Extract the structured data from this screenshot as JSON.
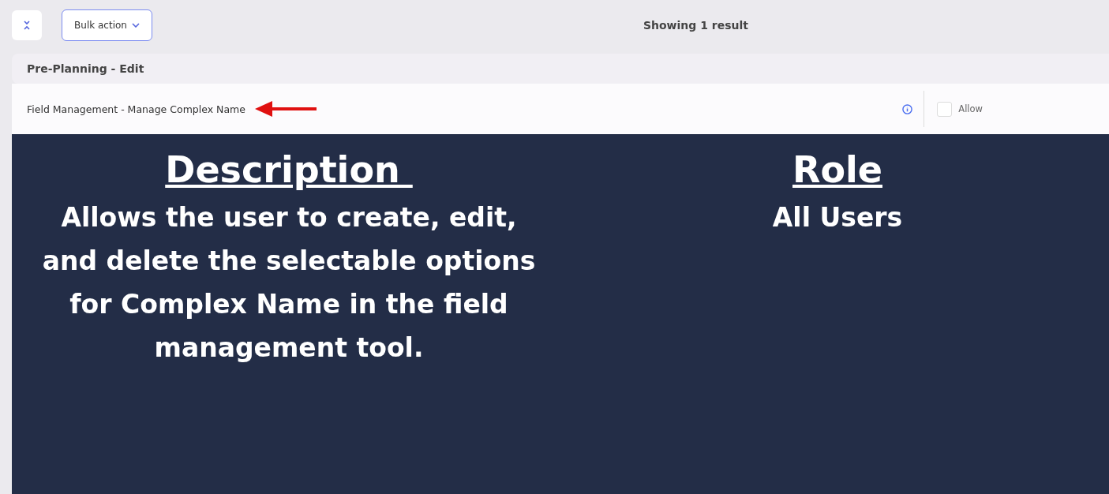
{
  "toolbar": {
    "bulk_action": "Bulk action",
    "result_count": "Showing 1 result"
  },
  "section": {
    "title": "Pre-Planning - Edit"
  },
  "permission": {
    "name": "Field Management - Manage Complex Name",
    "allow_label": "Allow",
    "checked": false
  },
  "overlay": {
    "description_heading": "Description ",
    "description": "Allows the user to create, edit, and delete the selectable options for Complex Name in the field management tool.",
    "role_heading": "Role",
    "role": "All Users"
  }
}
